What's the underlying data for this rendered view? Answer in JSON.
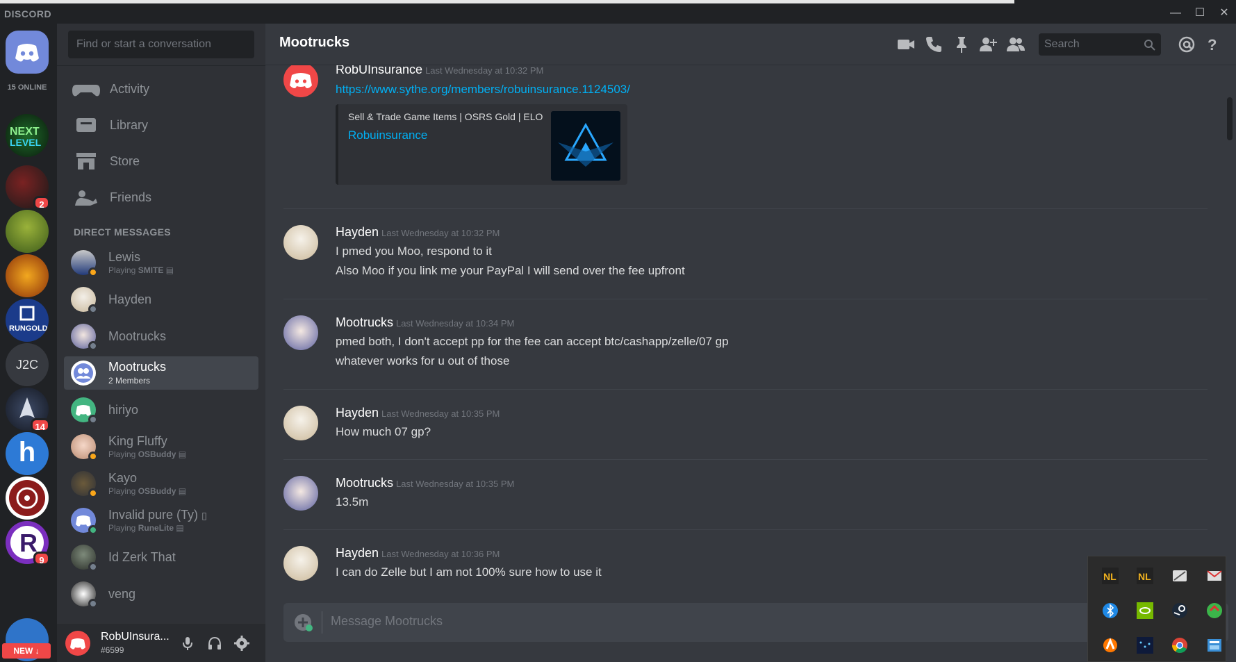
{
  "titlebar": {
    "brand": "DISCORD",
    "minimize": "—",
    "maximize": "☐",
    "close": "✕"
  },
  "servers": {
    "online_label": "15 ONLINE",
    "items": [
      {
        "kind": "home"
      },
      {
        "kind": "next-level"
      },
      {
        "kind": "resurgence",
        "badge": "2"
      },
      {
        "kind": "green-game"
      },
      {
        "kind": "rune-treasure"
      },
      {
        "kind": "rungold"
      },
      {
        "kind": "text",
        "label": "J2C"
      },
      {
        "kind": "shark",
        "badge": "14"
      },
      {
        "kind": "h-server",
        "label": "h"
      },
      {
        "kind": "wheel"
      },
      {
        "kind": "r-server",
        "label": "R",
        "badge": "9"
      },
      {
        "kind": "bottom"
      }
    ],
    "new_label": "NEW ↓"
  },
  "sidebar": {
    "search_placeholder": "Find or start a conversation",
    "nav": [
      {
        "label": "Activity"
      },
      {
        "label": "Library"
      },
      {
        "label": "Store"
      },
      {
        "label": "Friends"
      }
    ],
    "dm_header": "DIRECT MESSAGES",
    "dms": [
      {
        "name": "Lewis",
        "playing_prefix": "Playing",
        "game": "SMITE",
        "status": "idle"
      },
      {
        "name": "Hayden",
        "status": "off"
      },
      {
        "name": "Mootrucks",
        "status": "off"
      },
      {
        "name": "Mootrucks",
        "sub": "2 Members",
        "active": true
      },
      {
        "name": "hiriyo",
        "status": "off"
      },
      {
        "name": "King Fluffy",
        "playing_prefix": "Playing",
        "game": "OSBuddy",
        "status": "idle"
      },
      {
        "name": "Kayo",
        "playing_prefix": "Playing",
        "game": "OSBuddy",
        "status": "idle"
      },
      {
        "name": "Invalid pure (Ty)",
        "playing_prefix": "Playing",
        "game": "RuneLite",
        "status": "on"
      },
      {
        "name": "Id Zerk That",
        "status": "off"
      },
      {
        "name": "veng",
        "status": "off"
      }
    ]
  },
  "user": {
    "name": "RobUInsura...",
    "tag": "#6599"
  },
  "chat": {
    "title": "Mootrucks",
    "search_placeholder": "Search",
    "composer_placeholder": "Message Mootrucks",
    "messages": [
      {
        "author": "RobUInsurance",
        "time": "Last Wednesday at 10:32 PM",
        "link": "https://www.sythe.org/members/robuinsurance.1124503/",
        "embed": {
          "provider": "Sell & Trade Game Items | OSRS Gold | ELO",
          "title": "Robuinsurance"
        }
      },
      {
        "author": "Hayden",
        "time": "Last Wednesday at 10:32 PM",
        "lines": [
          "I pmed you Moo, respond to it",
          "Also Moo if you link me your PayPal I will send over the fee upfront"
        ]
      },
      {
        "author": "Mootrucks",
        "time": "Last Wednesday at 10:34 PM",
        "lines": [
          "pmed both, I don't accept pp for the fee can accept btc/cashapp/zelle/07 gp",
          "whatever works for u out of those"
        ]
      },
      {
        "author": "Hayden",
        "time": "Last Wednesday at 10:35 PM",
        "lines": [
          "How much 07 gp?"
        ]
      },
      {
        "author": "Mootrucks",
        "time": "Last Wednesday at 10:35 PM",
        "lines": [
          "13.5m"
        ]
      },
      {
        "author": "Hayden",
        "time": "Last Wednesday at 10:36 PM",
        "lines": [
          "I can do Zelle but I am not 100% sure how to use it"
        ]
      }
    ]
  },
  "colors": {
    "accent": "#7289da",
    "danger": "#f04747",
    "link": "#00b0f4",
    "online": "#43b581",
    "idle": "#faa61a",
    "offline": "#747f8d"
  }
}
